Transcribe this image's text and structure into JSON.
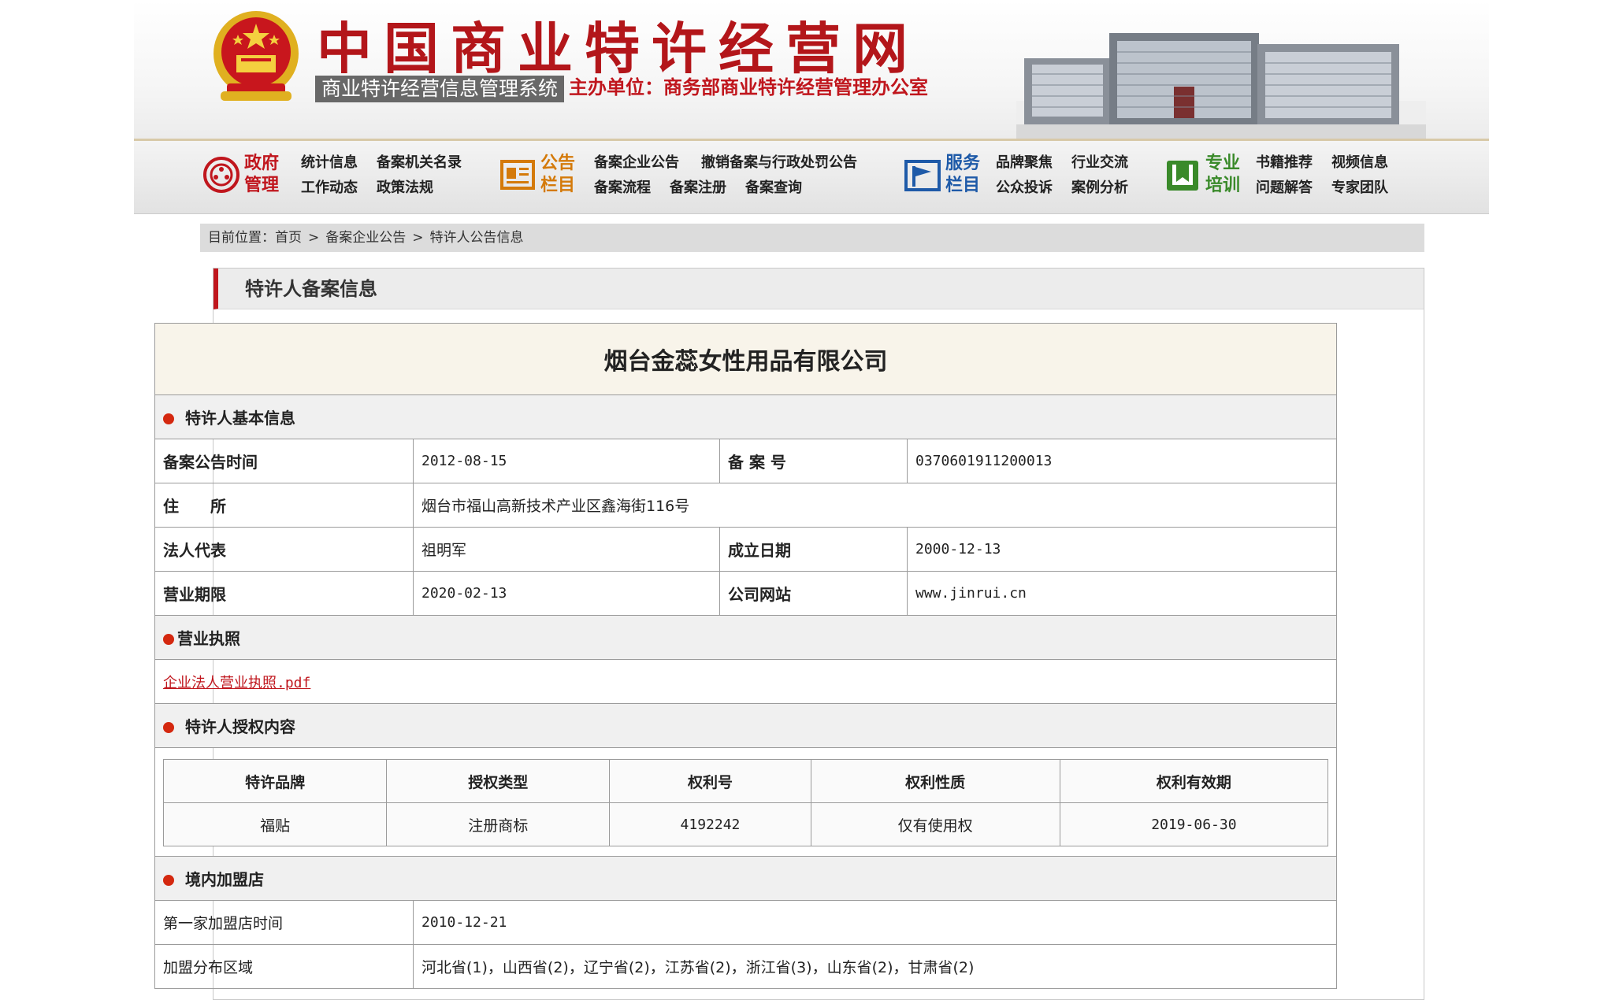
{
  "header": {
    "site_title": "中国商业特许经营网",
    "system_name": "商业特许经营信息管理系统",
    "sponsor": "主办单位：商务部商业特许经营管理办公室"
  },
  "nav": {
    "groups": [
      {
        "title": "政府管理",
        "color": "#c0161d",
        "icon": "government-icon",
        "links": [
          "统计信息",
          "备案机关名录",
          "工作动态",
          "政策法规"
        ]
      },
      {
        "title": "公告栏目",
        "color": "#d47a0a",
        "icon": "bulletin-icon",
        "links": [
          "备案企业公告",
          "撤销备案与行政处罚公告",
          "备案流程",
          "备案注册",
          "备案查询"
        ]
      },
      {
        "title": "服务栏目",
        "color": "#1e5aa8",
        "icon": "flag-icon",
        "links": [
          "品牌聚焦",
          "行业交流",
          "公众投诉",
          "案例分析"
        ]
      },
      {
        "title": "专业培训",
        "color": "#3a8a2a",
        "icon": "book-icon",
        "links": [
          "书籍推荐",
          "视频信息",
          "问题解答",
          "专家团队"
        ]
      }
    ]
  },
  "breadcrumb": {
    "prefix": "目前位置：",
    "items": [
      "首页",
      "备案企业公告",
      "特许人公告信息"
    ],
    "separator": ">"
  },
  "panel": {
    "title": "特许人备案信息",
    "company": "烟台金蕊女性用品有限公司",
    "basic": {
      "section": "特许人基本信息",
      "announce_label": "备案公告时间",
      "announce_value": "2012-08-15",
      "record_no_label": "备 案 号",
      "record_no_value": "0370601911200013",
      "address_label": "住　　所",
      "address_value": "烟台市福山高新技术产业区鑫海街116号",
      "legal_rep_label": "法人代表",
      "legal_rep_value": "祖明军",
      "founded_label": "成立日期",
      "founded_value": "2000-12-13",
      "term_label": "营业期限",
      "term_value": "2020-02-13",
      "website_label": "公司网站",
      "website_value": "www.jinrui.cn"
    },
    "license": {
      "section": "营业执照",
      "file": "企业法人营业执照.pdf"
    },
    "authorization": {
      "section": "特许人授权内容",
      "headers": [
        "特许品牌",
        "授权类型",
        "权利号",
        "权利性质",
        "权利有效期"
      ],
      "rows": [
        [
          "福贴",
          "注册商标",
          "4192242",
          "仅有使用权",
          "2019-06-30"
        ]
      ]
    },
    "stores": {
      "section": "境内加盟店",
      "first_label": "第一家加盟店时间",
      "first_value": "2010-12-21",
      "region_label": "加盟分布区域",
      "region_value": "河北省(1)，山西省(2)，辽宁省(2)，江苏省(2)，浙江省(3)，山东省(2)，甘肃省(2)"
    }
  }
}
